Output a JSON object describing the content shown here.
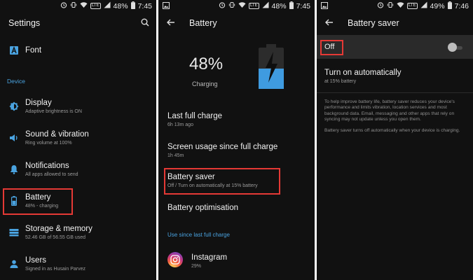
{
  "status_bars": [
    {
      "battery_pct": "48%",
      "time": "7:45",
      "network": "LTE"
    },
    {
      "battery_pct": "48%",
      "time": "7:45",
      "network": "LTE"
    },
    {
      "battery_pct": "49%",
      "time": "7:46",
      "network": "LTE"
    }
  ],
  "settings": {
    "title": "Settings",
    "font_item": {
      "title": "Font"
    },
    "section": "Device",
    "items": [
      {
        "title": "Display",
        "sub": "Adaptive brightness is ON",
        "icon": "brightness-icon"
      },
      {
        "title": "Sound & vibration",
        "sub": "Ring volume at 100%",
        "icon": "speaker-icon"
      },
      {
        "title": "Notifications",
        "sub": "All apps allowed to send",
        "icon": "bell-icon"
      },
      {
        "title": "Battery",
        "sub": "48% - charging",
        "icon": "battery-icon"
      },
      {
        "title": "Storage & memory",
        "sub": "52.46 GB of 56.55 GB used",
        "icon": "storage-icon"
      },
      {
        "title": "Users",
        "sub": "Signed in as Husain Parvez",
        "icon": "user-icon"
      }
    ]
  },
  "battery": {
    "title": "Battery",
    "percent": "48%",
    "state": "Charging",
    "last_full_charge": {
      "title": "Last full charge",
      "sub": "6h 13m ago"
    },
    "screen_usage": {
      "title": "Screen usage since full charge",
      "sub": "1h 45m"
    },
    "battery_saver": {
      "title": "Battery saver",
      "sub": "Off / Turn on automatically at 15% battery"
    },
    "optimisation": {
      "title": "Battery optimisation"
    },
    "usage_label": "Use since last full charge",
    "app": {
      "name": "Instagram",
      "sub": "29%"
    }
  },
  "saver": {
    "title": "Battery saver",
    "toggle_label": "Off",
    "toggle_on": false,
    "auto": {
      "title": "Turn on automatically",
      "sub": "at 15% battery"
    },
    "para1": "To help improve battery life, battery saver reduces your device's performance and limits vibration, location services and most background data. Email, messaging and other apps that rely on syncing may not update unless you open them.",
    "para2": "Battery saver turns off automatically when your device is charging."
  },
  "colors": {
    "accent": "#4aa3e0",
    "highlight": "#e53935",
    "background": "#111111"
  }
}
